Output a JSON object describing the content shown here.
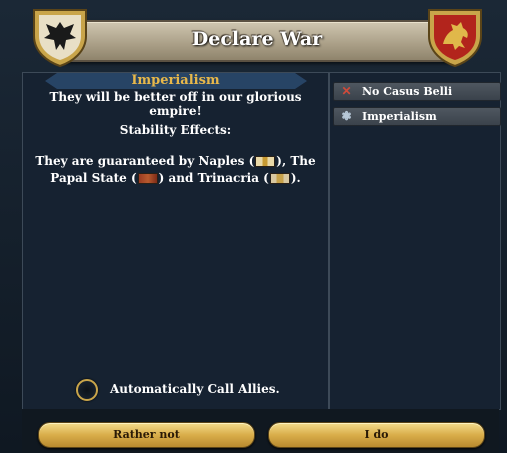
{
  "window": {
    "title": "Declare War"
  },
  "casus_belli": {
    "heading": "Imperialism",
    "description": "They will be better off in our glorious empire!"
  },
  "stability": {
    "heading": "Stability Effects:",
    "line1_prefix": "They are guaranteed by Naples (",
    "line1_mid": "), The",
    "line2_prefix": "Papal State (",
    "line2_mid": ") and Trinacria (",
    "line2_suffix": ")."
  },
  "allies_option": {
    "label": "Automatically Call Allies.",
    "checked": false
  },
  "cb_list": [
    {
      "label": "No Casus Belli",
      "icon": "x-icon",
      "icon_color": "#d04a3a"
    },
    {
      "label": "Imperialism",
      "icon": "crest-icon",
      "icon_color": "#b7c8d8"
    }
  ],
  "buttons": {
    "cancel": "Rather not",
    "confirm": "I do"
  },
  "colors": {
    "accent_gold": "#e8b84a",
    "panel_bg": "#162231"
  }
}
